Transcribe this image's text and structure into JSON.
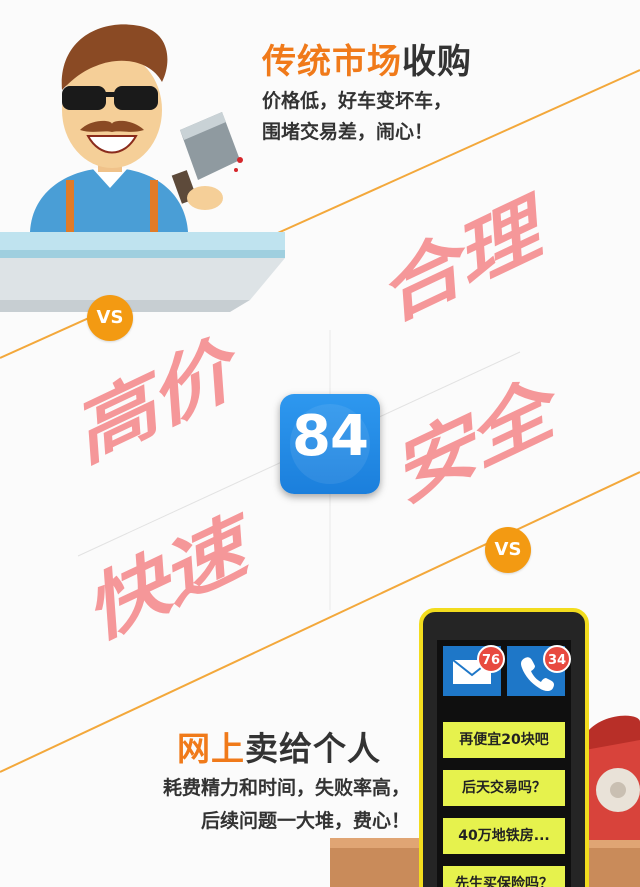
{
  "top": {
    "title_highlight": "传统市场",
    "title_rest": "收购",
    "line1": "价格低，好车变坏车，",
    "line2": "围堵交易差，闹心！"
  },
  "vs_label": "VS",
  "words": {
    "w1": "高价",
    "w2": "快速",
    "w3": "合理",
    "w4": "安全"
  },
  "app_icon": {
    "number": "84",
    "color": "#1f86e0"
  },
  "bottom": {
    "title_highlight": "网上",
    "title_rest": "卖给个人",
    "line1": "耗费精力和时间，失败率高，",
    "line2": "后续问题一大堆，费心！"
  },
  "phone": {
    "mail_badge": "76",
    "call_badge": "34",
    "messages": [
      "再便宜20块吧",
      "后天交易吗？",
      "40万地铁房...",
      "先生买保险吗？"
    ]
  },
  "colors": {
    "accent_orange": "#f07a1a",
    "word_pink": "#f59799",
    "vs_orange": "#f39a12",
    "phone_yellow": "#f2dc1e"
  }
}
